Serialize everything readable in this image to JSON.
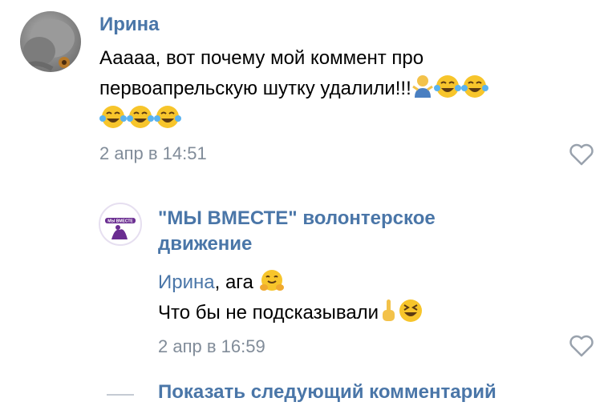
{
  "comments": [
    {
      "author": "Ирина",
      "text_line1": "Ааааа, вот почему мой коммент про",
      "text_line2": "первоапрельскую шутку удалили!!!",
      "date": "2 апр в 14:51"
    }
  ],
  "reply": {
    "author_line1": "\"МЫ ВМЕСТЕ\" волонтерское",
    "author_line2": "движение",
    "mention": "Ирина",
    "text_line1_suffix": ", ага",
    "text_line2": "Что бы не подсказывали",
    "date": "2 апр в 16:59",
    "avatar_logo_text": "МЫ ВМЕСТЕ"
  },
  "footer": {
    "next_comment_label": "Показать следующий комментарий"
  },
  "colors": {
    "link": "#4a76a8",
    "meta": "#818c99",
    "text": "#000000"
  },
  "icons": [
    "cat-avatar",
    "org-logo-avatar",
    "heart-icon",
    "person-shrug-emoji",
    "crying-laughing-emoji",
    "hugging-emoji",
    "pointing-up-emoji",
    "grinning-squint-emoji"
  ]
}
